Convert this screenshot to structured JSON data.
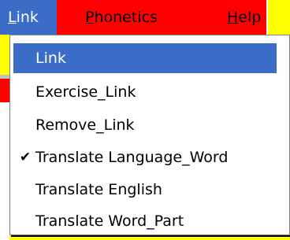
{
  "menubar": {
    "items": [
      {
        "label": "Link",
        "mnemonic": "L",
        "rest": "ink",
        "active": true
      },
      {
        "label": "Phonetics",
        "mnemonic": "P",
        "rest": "honetics",
        "active": false
      },
      {
        "label": "Help",
        "mnemonic": "H",
        "rest": "elp",
        "active": false
      }
    ]
  },
  "dropdown": {
    "items": [
      {
        "label": "Link",
        "checked": false,
        "highlighted": true
      },
      {
        "label": "Exercise_Link",
        "checked": false,
        "highlighted": false
      },
      {
        "label": "Remove_Link",
        "checked": false,
        "highlighted": false
      },
      {
        "label": "Translate Language_Word",
        "checked": true,
        "highlighted": false
      },
      {
        "label": "Translate English",
        "checked": false,
        "highlighted": false
      },
      {
        "label": "Translate Word_Part",
        "checked": false,
        "highlighted": false
      }
    ],
    "check_icon": "checkmark-icon",
    "check_glyph": "✔"
  },
  "colors": {
    "menubar_bg": "#ff0000",
    "highlight_bg": "#3a6cc8",
    "background": "#ffff00"
  }
}
